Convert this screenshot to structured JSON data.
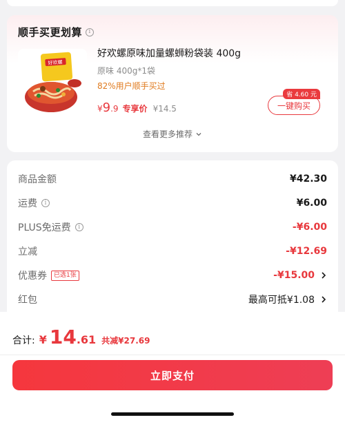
{
  "recommendation": {
    "title": "顺手买更划算",
    "info_icon": "i",
    "product": {
      "name": "好欢螺原味加量螺蛳粉袋装 400g",
      "spec": "原味 400g*1袋",
      "rate": "82%用户顺手买过",
      "price_symbol": "¥",
      "price_int": "9",
      "price_dec": ".9",
      "price_tag": "专享价",
      "orig_price": "¥14.5",
      "save_badge": "省 4.60 元",
      "buy_label": "一键购买",
      "image_brand": "好欢螺"
    },
    "more_label": "查看更多推荐"
  },
  "summary": {
    "rows": [
      {
        "label": "商品金额",
        "value": "¥42.30"
      },
      {
        "label": "运费",
        "value": "¥6.00",
        "info": "i"
      },
      {
        "label": "PLUS免运费",
        "value": "-¥6.00",
        "info": "i"
      },
      {
        "label": "立减",
        "value": "-¥12.69"
      },
      {
        "label": "优惠券",
        "value": "-¥15.00",
        "tag": "已选1张"
      },
      {
        "label": "红包",
        "value": "最高可抵¥1.08"
      }
    ]
  },
  "footer": {
    "total_label": "合计:",
    "currency": "¥",
    "total_int": "14",
    "total_dec": ".61",
    "saved": "共减¥27.69",
    "pay_label": "立即支付"
  },
  "colors": {
    "accent": "#e8383d",
    "orange": "#e07a1d"
  }
}
